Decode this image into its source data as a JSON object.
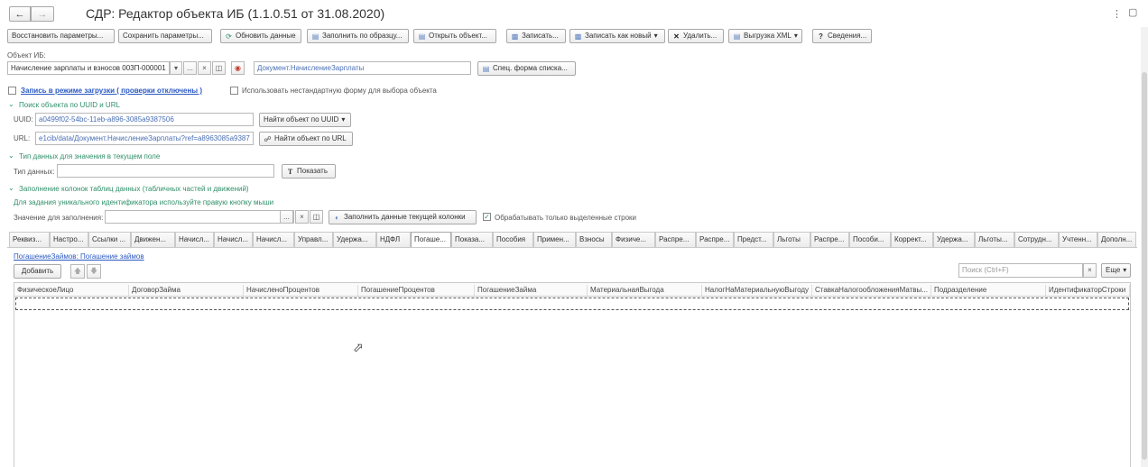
{
  "window": {
    "title": "СДР: Редактор объекта ИБ (1.1.0.51 от 31.08.2020)",
    "back_icon": "arrow-left-icon",
    "forward_icon": "arrow-right-icon",
    "kebab_icon": "kebab-icon",
    "expand_icon": "expand-icon"
  },
  "toolbar": {
    "restore": "Восстановить параметры...",
    "save_params": "Сохранить параметры...",
    "refresh": "Обновить данные",
    "fill_sample": "Заполнить по образцу...",
    "open_object": "Открыть объект...",
    "write": "Записать...",
    "write_new": "Записать как новый",
    "delete": "Удалить...",
    "export_xml": "Выгрузка XML",
    "info": "Сведения..."
  },
  "object": {
    "label": "Объект ИБ:",
    "value": "Начисление зарплаты и взносов 003П-000001",
    "type_value": "Документ.НачислениеЗарплаты",
    "special_form": "Спец. форма списка..."
  },
  "options": {
    "load_mode": "Запись в режиме загрузки ( проверки отключены )",
    "nonstandard_form": "Использовать нестандартную форму для выбора объекта"
  },
  "search_section": {
    "header": "Поиск объекта по UUID и URL",
    "uuid_label": "UUID:",
    "uuid_value": "a0499f02-54bc-11eb-a896-3085a9387506",
    "find_uuid": "Найти объект по UUID",
    "url_label": "URL:",
    "url_value": "e1cib/data/Документ.НачислениеЗарплаты?ref=a8963085a9387",
    "find_url": "Найти объект по URL"
  },
  "type_section": {
    "header": "Тип данных для значения в текущем поле",
    "label": "Тип данных:",
    "show": "Показать"
  },
  "fill_section": {
    "header": "Заполнение колонок таблиц данных (табличных частей и движений)",
    "hint": "Для задания уникального идентификатора используйте правую кнопку мыши",
    "value_label": "Значение для заполнения:",
    "fill_button": "Заполнить данные текущей колонки",
    "only_selected": "Обрабатывать только выделенные строки"
  },
  "tabs": [
    "Реквиз...",
    "Настро...",
    "Ссылки ...",
    "Движен...",
    "Начисл...",
    "Начисл...",
    "Начисл...",
    "Управл...",
    "Удержа...",
    "НДФЛ",
    "Погаше...",
    "Показа...",
    "Пособия",
    "Примен...",
    "Взносы",
    "Физиче...",
    "Распре...",
    "Распре...",
    "Предст...",
    "Льготы",
    "Распре...",
    "Пособи...",
    "Коррект...",
    "Удержа...",
    "Льготы...",
    "Сотрудн...",
    "Учтенн...",
    "Дополн..."
  ],
  "table": {
    "path": "ПогашениеЗаймов: Погашение займов",
    "add": "Добавить",
    "search_placeholder": "Поиск (Ctrl+F)",
    "more": "Еще",
    "columns": [
      "ФизическоеЛицо",
      "ДоговорЗайма",
      "НачисленоПроцентов",
      "ПогашениеПроцентов",
      "ПогашениеЗайма",
      "МатериальнаяВыгода",
      "НалогНаМатериальнуюВыгоду",
      "СтавкаНалогообложенияМатвы...",
      "Подразделение",
      "ИдентификаторСтроки"
    ]
  }
}
